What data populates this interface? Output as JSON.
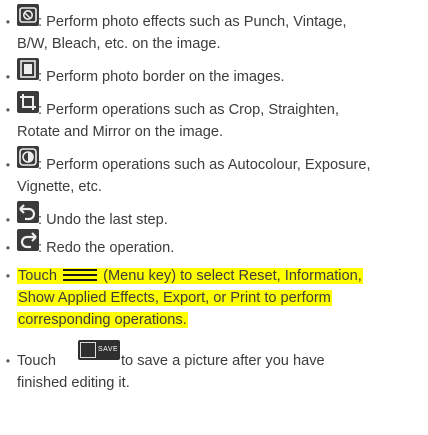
{
  "items": [
    {
      "icon": "photo-effects-icon",
      "lines": [
        ": Perform photo effects such as Punch, Vintage,",
        "B/W, Bleach, etc. on the image."
      ]
    },
    {
      "icon": "photo-border-icon",
      "lines": [
        ": Perform photo border on the images."
      ]
    },
    {
      "icon": "crop-rotate-icon",
      "lines": [
        ": Perform operations such as Crop, Straighten,",
        "Rotate and Mirror on the image."
      ]
    },
    {
      "icon": "adjust-icon",
      "lines": [
        ": Perform operations such as Autocolour, Exposure,",
        "Vignette, etc."
      ]
    },
    {
      "icon": "undo-icon",
      "lines": [
        ": Undo the last step."
      ]
    },
    {
      "icon": "redo-icon",
      "lines": [
        ": Redo the operation."
      ]
    }
  ],
  "touch_menu": {
    "prefix": "Touch",
    "icon": "menu-key-icon",
    "line1_rest": "(Menu key) to select Reset, Information,",
    "line2": "Show Applied Effects, Export, or Print to perform",
    "line3": "corresponding operations."
  },
  "touch_save": {
    "prefix": "Touch",
    "icon": "save-icon",
    "icon_label": "SAVE",
    "line1_rest": "to save a picture after you have",
    "line2": "finished editing it."
  },
  "bullet": "•",
  "colors": {
    "highlight": "#ffff00",
    "text": "#3c3c3c",
    "icon_bg": "#3a3a3a"
  }
}
